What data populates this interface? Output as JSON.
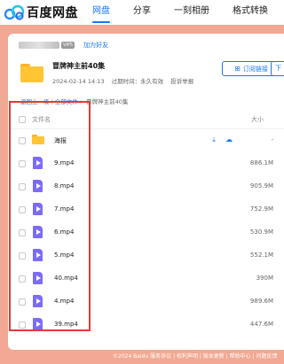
{
  "header": {
    "logo_text": "百度网盘",
    "nav": [
      "网盘",
      "分享",
      "一刻相册",
      "格式转换"
    ],
    "active_tab": 0
  },
  "share": {
    "vip_badge": "VIP5",
    "add_friend": "加为好友",
    "title": "冒牌神主前40集",
    "date": "2024-02-14 14:13",
    "expiry": "过期时间：永久有效",
    "report": "投诉举报",
    "order_button": "订阅链接",
    "download_button": "下"
  },
  "breadcrumb": {
    "back": "返回上一级",
    "all_files": "全部文件",
    "current": "冒牌神主前40集"
  },
  "list": {
    "col_name": "文件名",
    "col_size": "大小",
    "rows": [
      {
        "name": "海报",
        "size": "-",
        "type": "folder"
      },
      {
        "name": "9.mp4",
        "size": "886.1M",
        "type": "video"
      },
      {
        "name": "8.mp4",
        "size": "905.9M",
        "type": "video"
      },
      {
        "name": "7.mp4",
        "size": "752.9M",
        "type": "video"
      },
      {
        "name": "6.mp4",
        "size": "530.9M",
        "type": "video"
      },
      {
        "name": "5.mp4",
        "size": "552.1M",
        "type": "video"
      },
      {
        "name": "40.mp4",
        "size": "390M",
        "type": "video"
      },
      {
        "name": "4.mp4",
        "size": "989.6M",
        "type": "video"
      },
      {
        "name": "39.mp4",
        "size": "447.6M",
        "type": "video"
      }
    ]
  },
  "footer": {
    "text": "©2024 Baidu  服务协议 | 权利声明 | 版本更新 | 帮助中心 | 问题反馈"
  },
  "colors": {
    "accent": "#1677ff",
    "background": "#f2a892",
    "folder": "#ffc533",
    "video_icon": "#7b6cf6",
    "highlight": "#e53935"
  }
}
